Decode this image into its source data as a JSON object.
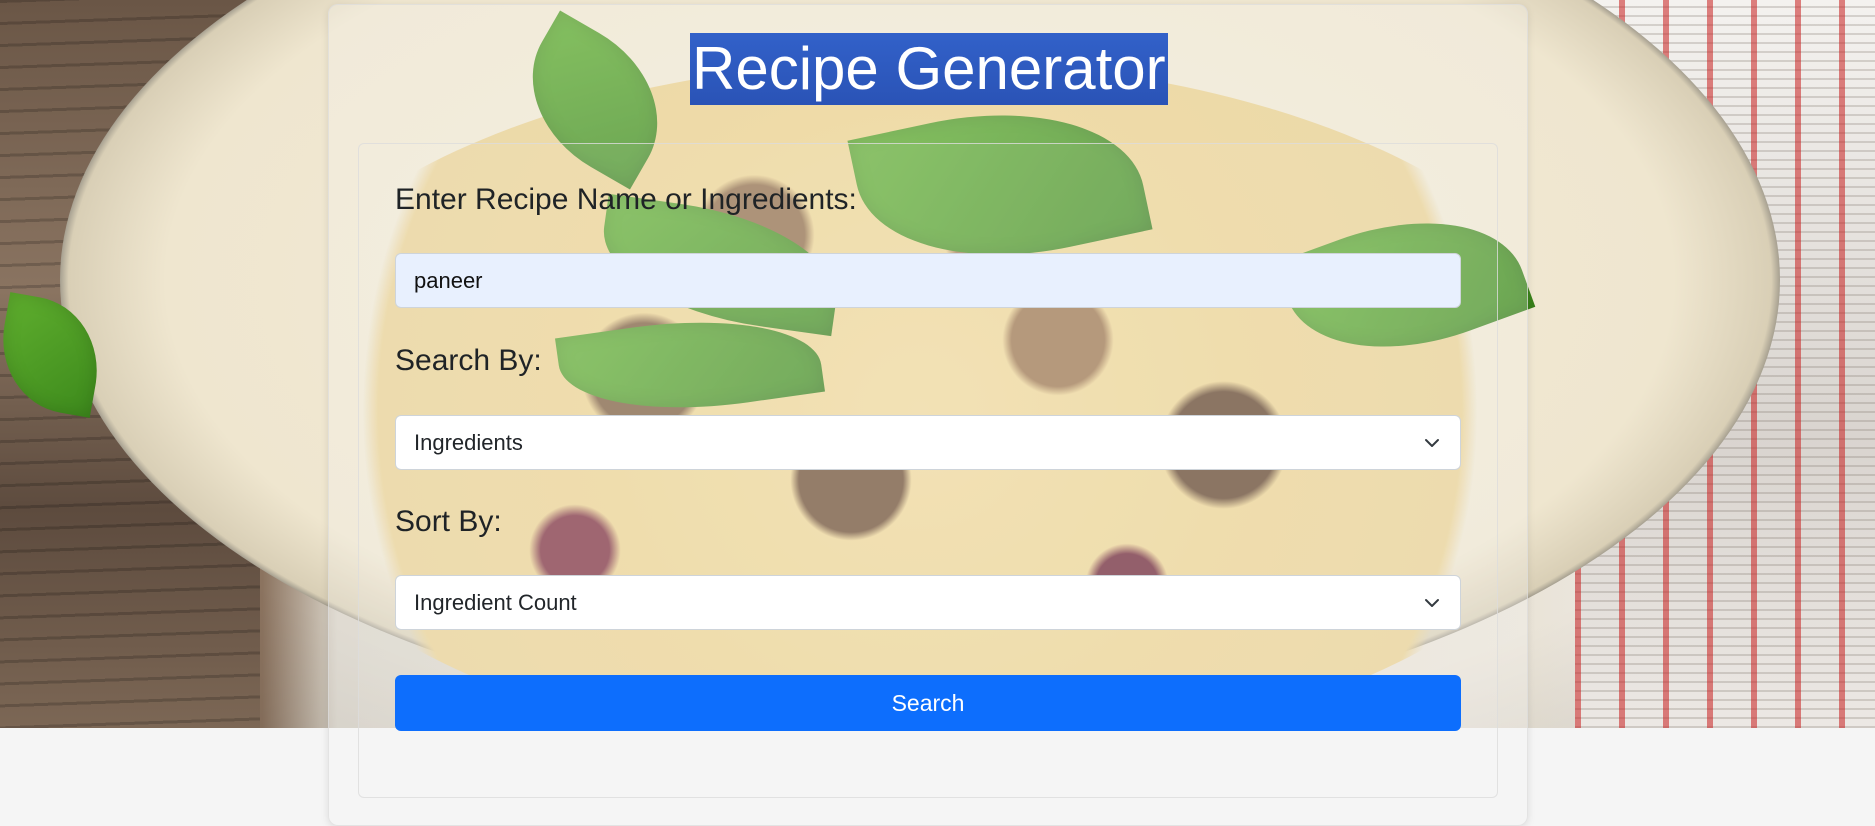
{
  "header": {
    "title": "Recipe Generator"
  },
  "form": {
    "query_label": "Enter Recipe Name or Ingredients:",
    "query_value": "paneer",
    "search_by_label": "Search By:",
    "search_by_value": "Ingredients",
    "sort_by_label": "Sort By:",
    "sort_by_value": "Ingredient Count",
    "search_button_label": "Search"
  },
  "icons": {
    "dropdown": "chevron-down-icon",
    "background": "food-photo"
  },
  "colors": {
    "primary_button": "#0d6efd",
    "title_highlight": "#2b59c3",
    "input_autofill": "#e8f0fe"
  }
}
